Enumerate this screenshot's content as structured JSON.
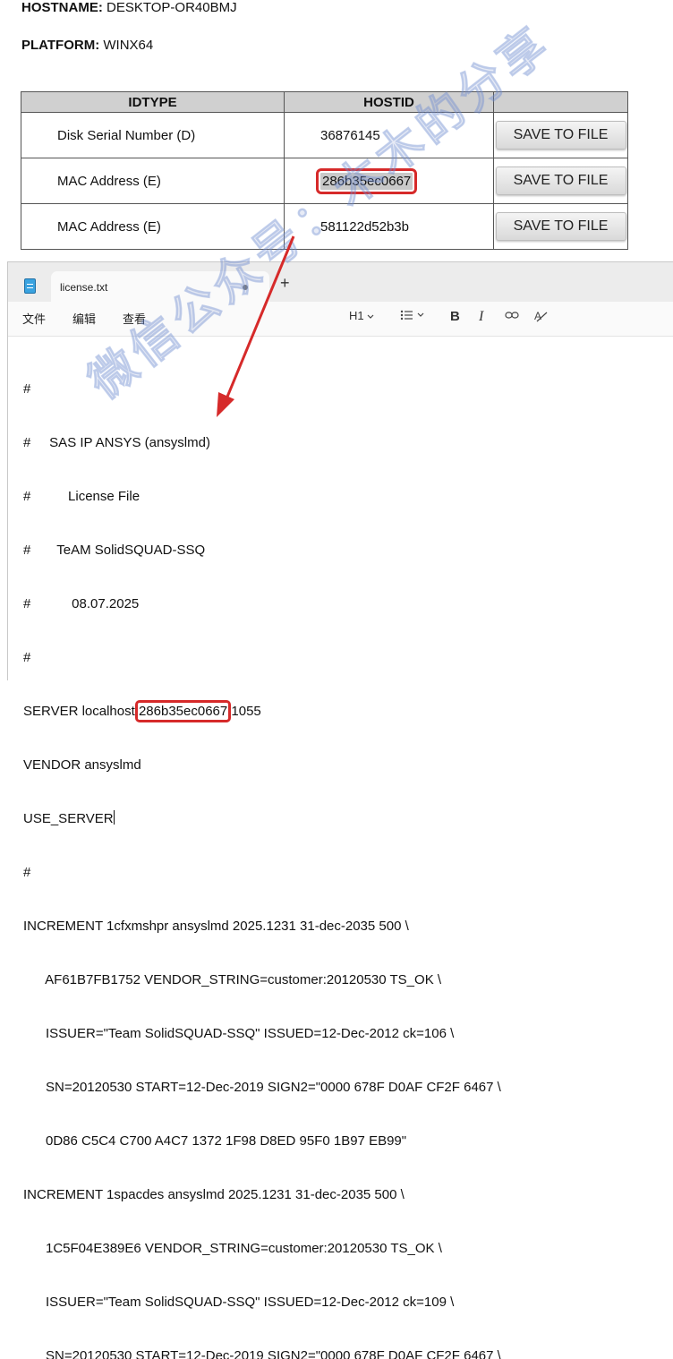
{
  "host_info": {
    "hostname_label": "HOSTNAME:",
    "hostname_value": "DESKTOP-OR40BMJ",
    "platform_label": "PLATFORM:",
    "platform_value": "WINX64"
  },
  "hostid_table": {
    "headers": [
      "IDTYPE",
      "HOSTID",
      ""
    ],
    "rows": [
      {
        "idtype": "Disk Serial Number (D)",
        "hostid": "36876145",
        "button": "SAVE TO FILE"
      },
      {
        "idtype": "MAC Address (E)",
        "hostid": "286b35ec0667",
        "button": "SAVE TO FILE",
        "highlighted": true
      },
      {
        "idtype": "MAC Address (E)",
        "hostid": "581122d52b3b",
        "button": "SAVE TO FILE"
      }
    ]
  },
  "notepad": {
    "tab_title": "license.txt",
    "new_tab_symbol": "+",
    "menu": [
      "文件",
      "编辑",
      "查看"
    ],
    "toolbar": {
      "heading": "H1",
      "bold": "B",
      "italic": "I"
    },
    "lines": [
      "#",
      "#     SAS IP ANSYS (ansyslmd)",
      "#          License File",
      "#       TeAM SolidSQUAD-SSQ",
      "#           08.07.2025",
      "#",
      "SERVER localhost ",
      "VENDOR ansyslmd",
      "USE_SERVER",
      "#",
      "INCREMENT 1cfxmshpr ansyslmd 2025.1231 31-dec-2035 500 \\",
      "      AF61B7FB1752 VENDOR_STRING=customer:20120530 TS_OK \\",
      "      ISSUER=\"Team SolidSQUAD-SSQ\" ISSUED=12-Dec-2012 ck=106 \\",
      "      SN=20120530 START=12-Dec-2019 SIGN2=\"0000 678F D0AF CF2F 6467 \\",
      "      0D86 C5C4 C700 A4C7 1372 1F98 D8ED 95F0 1B97 EB99\"",
      "INCREMENT 1spacdes ansyslmd 2025.1231 31-dec-2035 500 \\",
      "      1C5F04E389E6 VENDOR_STRING=customer:20120530 TS_OK \\",
      "      ISSUER=\"Team SolidSQUAD-SSQ\" ISSUED=12-Dec-2012 ck=109 \\",
      "      SN=20120530 START=12-Dec-2019 SIGN2=\"0000 678F D0AF CF2F 6467 \\"
    ],
    "server_hostid": "286b35ec0667",
    "server_port": " 1055"
  },
  "annotation_color": "#d62a2a",
  "watermark_text": "微信公众号：木木的分享"
}
